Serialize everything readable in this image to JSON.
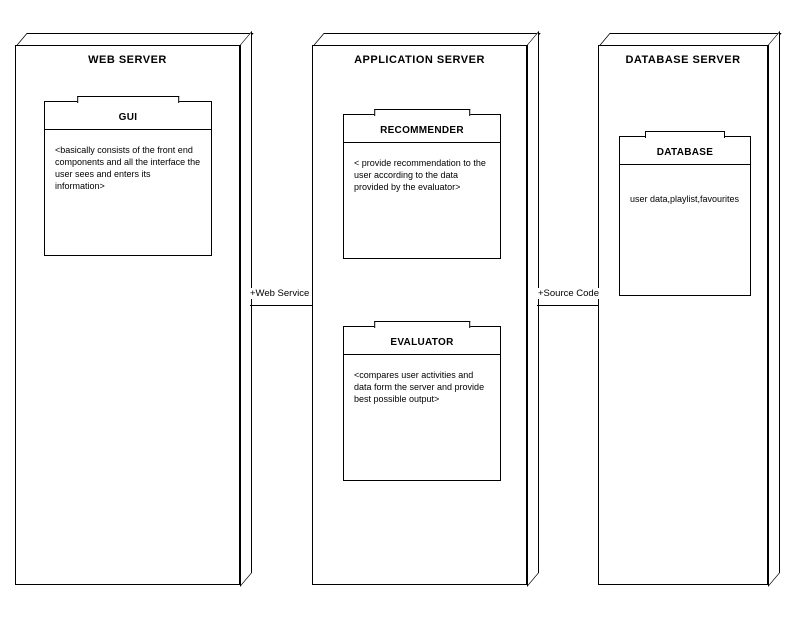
{
  "nodes": {
    "web_server": {
      "title": "WEB SERVER"
    },
    "app_server": {
      "title": "APPLICATION SERVER"
    },
    "db_server": {
      "title": "DATABASE SERVER"
    }
  },
  "components": {
    "gui": {
      "title": "GUI",
      "body": "<basically consists of the front end components and all the interface the user sees and enters its information>"
    },
    "recommender": {
      "title": "RECOMMENDER",
      "body": "< provide recommendation to the user according to the data provided by the evaluator>"
    },
    "evaluator": {
      "title": "EVALUATOR",
      "body": "<compares user activities and data form the server and provide best possible output>"
    },
    "database": {
      "title": "DATABASE",
      "body": "user data,playlist,favourites"
    }
  },
  "connectors": {
    "web_service": "+Web Service",
    "source_code": "+Source Code"
  }
}
